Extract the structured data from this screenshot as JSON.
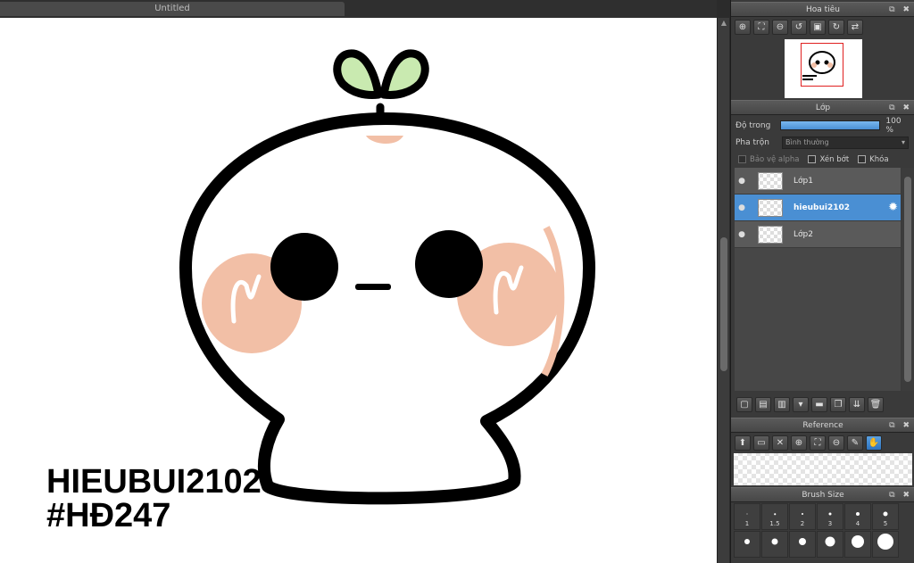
{
  "document": {
    "tab_title": "Untitled",
    "watermark_line1": "HIEUBUI2102",
    "watermark_line2": "#HĐ247"
  },
  "colors": {
    "accent": "#4a8fd3",
    "panel_bg": "#3a3a3a",
    "sprout_leaf": "#c9eab0",
    "blush": "#f2bfa6"
  },
  "navigator": {
    "title": "Hoa tiêu",
    "header_controls": "⧉ ✖",
    "tools": [
      {
        "icon": "zoom-in-icon",
        "glyph": "⊕"
      },
      {
        "icon": "fit-window-icon",
        "glyph": "⛶"
      },
      {
        "icon": "zoom-out-icon",
        "glyph": "⊖"
      },
      {
        "icon": "rotate-left-icon",
        "glyph": "↺"
      },
      {
        "icon": "reset-view-icon",
        "glyph": "▣"
      },
      {
        "icon": "rotate-right-icon",
        "glyph": "↻"
      },
      {
        "icon": "flip-horizontal-icon",
        "glyph": "⇄"
      }
    ]
  },
  "layers": {
    "title": "Lớp",
    "header_controls": "⧉ ✖",
    "opacity_label": "Độ trong",
    "opacity_value": "100 %",
    "opacity_fraction": 1.0,
    "blend_label": "Pha trộn",
    "blend_value": "Bình thường",
    "protect_alpha_label": "Bảo vệ alpha",
    "clipping_label": "Xén bớt",
    "lock_label": "Khóa",
    "items": [
      {
        "name": "Lớp1",
        "selected": false
      },
      {
        "name": "hieubui2102",
        "selected": true
      },
      {
        "name": "Lớp2",
        "selected": false
      }
    ],
    "actions": [
      {
        "icon": "new-layer-icon",
        "glyph": "▢"
      },
      {
        "icon": "new-halftone-layer-icon",
        "glyph": "▤"
      },
      {
        "icon": "new-1bit-layer-icon",
        "glyph": "▥"
      },
      {
        "icon": "add-layer-menu-icon",
        "glyph": "▾"
      },
      {
        "icon": "new-folder-icon",
        "glyph": "▬"
      },
      {
        "icon": "duplicate-layer-icon",
        "glyph": "❐"
      },
      {
        "icon": "merge-down-icon",
        "glyph": "⇊"
      },
      {
        "icon": "delete-layer-icon",
        "glyph": "🗑"
      }
    ]
  },
  "reference": {
    "title": "Reference",
    "header_controls": "⧉ ✖",
    "tools": [
      {
        "icon": "upload-icon",
        "glyph": "⬆"
      },
      {
        "icon": "open-folder-icon",
        "glyph": "▭"
      },
      {
        "icon": "close-icon",
        "glyph": "✕"
      },
      {
        "icon": "zoom-in-icon",
        "glyph": "⊕"
      },
      {
        "icon": "fit-window-icon",
        "glyph": "⛶"
      },
      {
        "icon": "zoom-out-icon",
        "glyph": "⊖"
      },
      {
        "icon": "eyedropper-icon",
        "glyph": "✎"
      },
      {
        "icon": "hand-icon",
        "glyph": "✋"
      }
    ]
  },
  "brush_size": {
    "title": "Brush Size",
    "header_controls": "⧉ ✖",
    "row1": [
      {
        "label": "1",
        "dot": 1
      },
      {
        "label": "1.5",
        "dot": 1.5
      },
      {
        "label": "2",
        "dot": 2
      },
      {
        "label": "3",
        "dot": 3
      },
      {
        "label": "4",
        "dot": 4
      },
      {
        "label": "5",
        "dot": 5
      }
    ],
    "row2": [
      {
        "label": "",
        "dot": 6
      },
      {
        "label": "",
        "dot": 7
      },
      {
        "label": "",
        "dot": 8
      },
      {
        "label": "",
        "dot": 11
      },
      {
        "label": "",
        "dot": 14
      },
      {
        "label": "",
        "dot": 18
      }
    ]
  }
}
